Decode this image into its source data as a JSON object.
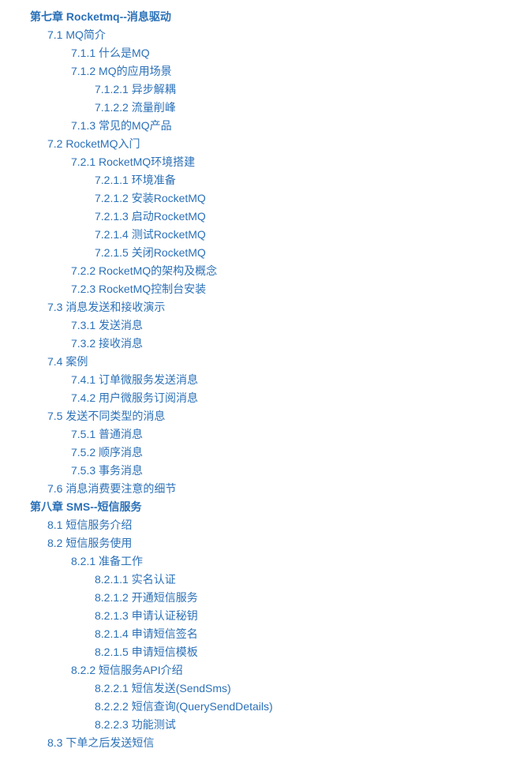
{
  "toc": [
    {
      "level": 1,
      "chapter": true,
      "text": "第七章 Rocketmq--消息驱动"
    },
    {
      "level": 2,
      "text": "7.1 MQ简介"
    },
    {
      "level": 3,
      "text": "7.1.1 什么是MQ"
    },
    {
      "level": 3,
      "text": "7.1.2 MQ的应用场景"
    },
    {
      "level": 4,
      "text": "7.1.2.1 异步解耦"
    },
    {
      "level": 4,
      "text": "7.1.2.2 流量削峰"
    },
    {
      "level": 3,
      "text": "7.1.3 常见的MQ产品"
    },
    {
      "level": 2,
      "text": "7.2 RocketMQ入门"
    },
    {
      "level": 3,
      "text": "7.2.1 RocketMQ环境搭建"
    },
    {
      "level": 4,
      "text": "7.2.1.1 环境准备"
    },
    {
      "level": 4,
      "text": "7.2.1.2 安装RocketMQ"
    },
    {
      "level": 4,
      "text": "7.2.1.3 启动RocketMQ"
    },
    {
      "level": 4,
      "text": "7.2.1.4 测试RocketMQ"
    },
    {
      "level": 4,
      "text": "7.2.1.5 关闭RocketMQ"
    },
    {
      "level": 3,
      "text": "7.2.2 RocketMQ的架构及概念"
    },
    {
      "level": 3,
      "text": "7.2.3 RocketMQ控制台安装"
    },
    {
      "level": 2,
      "text": "7.3 消息发送和接收演示"
    },
    {
      "level": 3,
      "text": "7.3.1 发送消息"
    },
    {
      "level": 3,
      "text": "7.3.2 接收消息"
    },
    {
      "level": 2,
      "text": "7.4 案例"
    },
    {
      "level": 3,
      "text": "7.4.1 订单微服务发送消息"
    },
    {
      "level": 3,
      "text": "7.4.2 用户微服务订阅消息"
    },
    {
      "level": 2,
      "text": "7.5 发送不同类型的消息"
    },
    {
      "level": 3,
      "text": "7.5.1 普通消息"
    },
    {
      "level": 3,
      "text": "7.5.2 顺序消息"
    },
    {
      "level": 3,
      "text": "7.5.3 事务消息"
    },
    {
      "level": 2,
      "text": "7.6 消息消费要注意的细节"
    },
    {
      "level": 1,
      "chapter": true,
      "text": "第八章 SMS--短信服务"
    },
    {
      "level": 2,
      "text": "8.1 短信服务介绍"
    },
    {
      "level": 2,
      "text": "8.2 短信服务使用"
    },
    {
      "level": 3,
      "text": "8.2.1 准备工作"
    },
    {
      "level": 4,
      "text": "8.2.1.1 实名认证"
    },
    {
      "level": 4,
      "text": "8.2.1.2 开通短信服务"
    },
    {
      "level": 4,
      "text": "8.2.1.3 申请认证秘钥"
    },
    {
      "level": 4,
      "text": "8.2.1.4 申请短信签名"
    },
    {
      "level": 4,
      "text": "8.2.1.5 申请短信模板"
    },
    {
      "level": 3,
      "text": "8.2.2 短信服务API介绍"
    },
    {
      "level": 4,
      "text": "8.2.2.1 短信发送(SendSms)"
    },
    {
      "level": 4,
      "text": "8.2.2.2 短信查询(QuerySendDetails)"
    },
    {
      "level": 4,
      "text": "8.2.2.3 功能测试"
    },
    {
      "level": 2,
      "text": "8.3 下单之后发送短信"
    }
  ]
}
